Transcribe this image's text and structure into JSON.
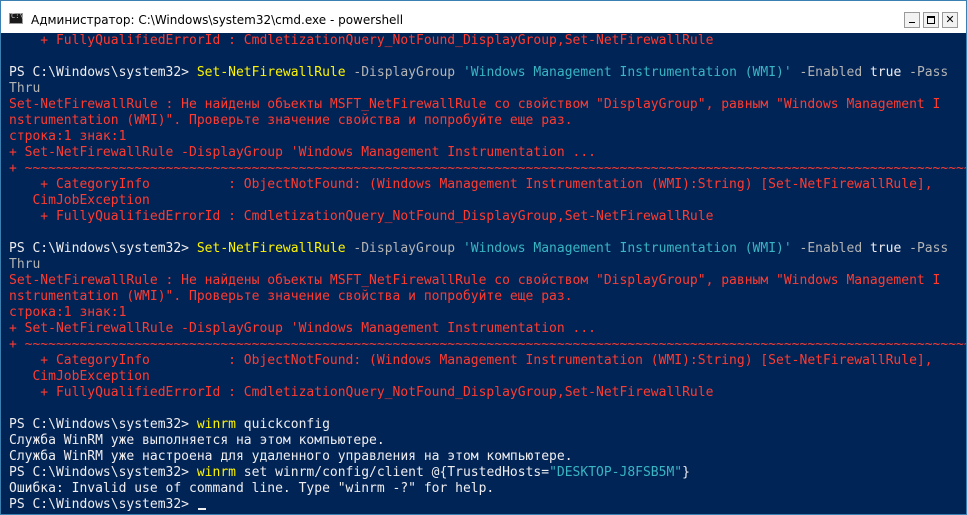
{
  "window": {
    "title": "Администратор: C:\\Windows\\system32\\cmd.exe - powershell",
    "controls": {
      "minimize": "",
      "maximize": "",
      "close": "✕"
    }
  },
  "colors": {
    "background": "#012456",
    "foreground": "#eeedf0",
    "error": "#ff3b30",
    "command": "#fff500",
    "string": "#39b5c3",
    "parameter": "#b4b4b4"
  },
  "console": {
    "prompt": "PS C:\\Windows\\system32> ",
    "lines": [
      "    + FullyQualifiedErrorId : CmdletizationQuery_NotFound_DisplayGroup,Set-NetFirewallRule",
      "",
      "Set-NetFirewallRule",
      " -DisplayGroup ",
      "'Windows Management Instrumentation (WMI)'",
      " -Enabled ",
      "true",
      " -Pass",
      "Thru",
      "Set-NetFirewallRule : Не найдены объекты MSFT_NetFirewallRule со свойством \"DisplayGroup\", равным \"Windows Management I",
      "nstrumentation (WMI)\". Проверьте значение свойства и попробуйте еще раз.",
      "строка:1 знак:1",
      "+ Set-NetFirewallRule -DisplayGroup 'Windows Management Instrumentation ...",
      "+ ~~~~~~~~~~~~~~~~~~~~~~~~~~~~~~~~~~~~~~~~~~~~~~~~~~~~~~~~~~~~~~~~~~~~~~~~~~~~~~~~~~~~~~~~~~~~~~~~~~~~~~~~~~~~~~~~~~~~~~~~~~~~~~~~~~~",
      "    + CategoryInfo          : ObjectNotFound: (Windows Management Instrumentation (WMI):String) [Set-NetFirewallRule],",
      "   CimJobException",
      "    + FullyQualifiedErrorId : CmdletizationQuery_NotFound_DisplayGroup,Set-NetFirewallRule",
      "winrm",
      " quickconfig",
      "Служба WinRM уже выполняется на этом компьютере.",
      "Служба WinRM уже настроена для удаленного управления на этом компьютере.",
      " set winrm/config/client @{TrustedHosts=",
      "\"DESKTOP-J8FSB5M\"",
      "}",
      "Ошибка: Invalid use of command line. Type \"winrm -?\" for help."
    ]
  }
}
